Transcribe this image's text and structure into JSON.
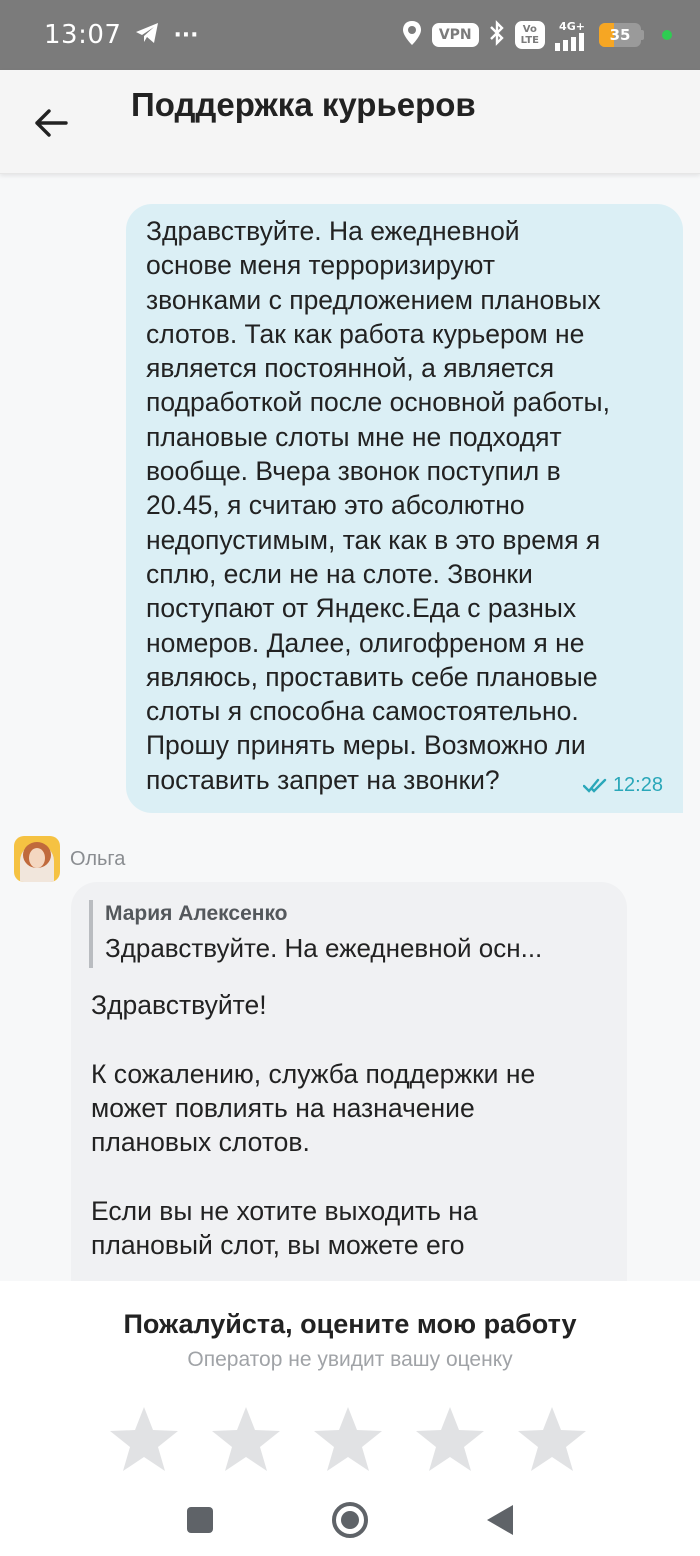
{
  "status_bar": {
    "time": "13:07",
    "dots": "···",
    "vpn": "VPN",
    "volte": "Vo\nLTE",
    "network": "4G+",
    "battery": "35",
    "battery_level": 0.35,
    "icons": [
      "telegram-icon",
      "location-icon",
      "bluetooth-icon",
      "signal-icon"
    ]
  },
  "header": {
    "title": "Поддержка курьеров",
    "back_icon": "arrow-left-icon"
  },
  "messages": {
    "outgoing": {
      "text": "Здравствуйте. На ежедневной\nоснове меня терроризируют\nзвонками с предложением плановых\nслотов. Так как работа курьером не\nявляется постоянной, а является\nподработкой после основной работы,\nплановые слоты мне не подходят\nвообще. Вчера звонок поступил в\n20.45, я считаю это абсолютно\nнедопустимым, так как в это время я\nсплю, если не на слоте. Звонки\nпоступают от Яндекс.Еда с разных\nномеров. Далее, олигофреном я не\nявляюсь, проставить себе плановые\nслоты я способна самостоятельно.\nПрошу принять меры. Возможно ли\nпоставить запрет на звонки?",
      "time": "12:28",
      "status_icon": "double-check-icon"
    },
    "incoming": {
      "operator_name": "Ольга",
      "quote_author": "Мария Алексенко",
      "quote_text": "Здравствуйте. На ежедневной осн...",
      "text": "Здравствуйте!\n\nК сожалению, служба поддержки не\nможет повлиять на назначение\nплановых слотов.\n\nЕсли вы не хотите выходить на\nплановый слот, вы можете его"
    }
  },
  "rating": {
    "title": "Пожалуйста, оцените мою работу",
    "subtitle": "Оператор не увидит вашу оценку",
    "max_stars": 5,
    "selected": 0,
    "star_color": "#e1e2e4"
  },
  "nav": {
    "icons": [
      "recents-square-icon",
      "home-circle-icon",
      "back-triangle-icon"
    ]
  },
  "colors": {
    "outgoing_bubble": "#dbeff5",
    "incoming_bubble": "#f0f1f3",
    "time_accent": "#2aa7b9",
    "status_bar": "#7b7b7b",
    "battery": "#f6a623"
  }
}
